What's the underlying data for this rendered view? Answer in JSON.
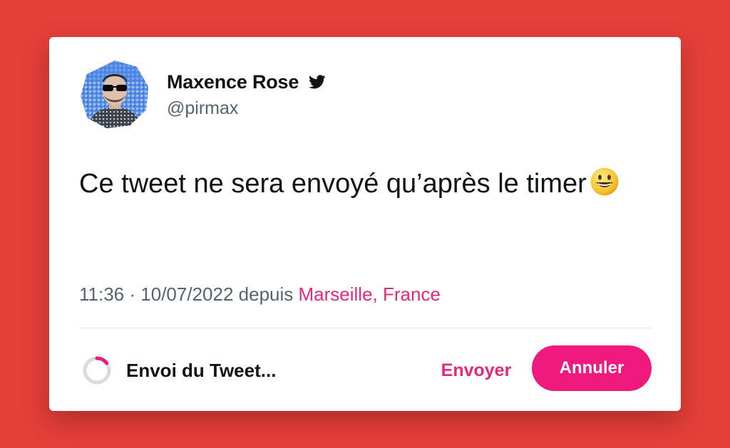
{
  "colors": {
    "background": "#e5403a",
    "accent": "#e6287a",
    "cancel_button": "#f0197d",
    "text": "#0f1419",
    "muted": "#536471"
  },
  "tweet": {
    "author": {
      "name": "Maxence Rose",
      "handle": "@pirmax",
      "verified_icon": "twitter-bird-icon",
      "avatar": "avatar-man-sunglasses"
    },
    "text": "Ce tweet ne sera envoyé qu’après le timer",
    "emoji": "grinning-face-emoji",
    "time": "11:36",
    "separator": "·",
    "date": "10/07/2022",
    "via": "depuis",
    "location": "Marseille, France"
  },
  "footer": {
    "status": "Envoi du Tweet...",
    "progress": 0.15,
    "send_label": "Envoyer",
    "cancel_label": "Annuler"
  }
}
